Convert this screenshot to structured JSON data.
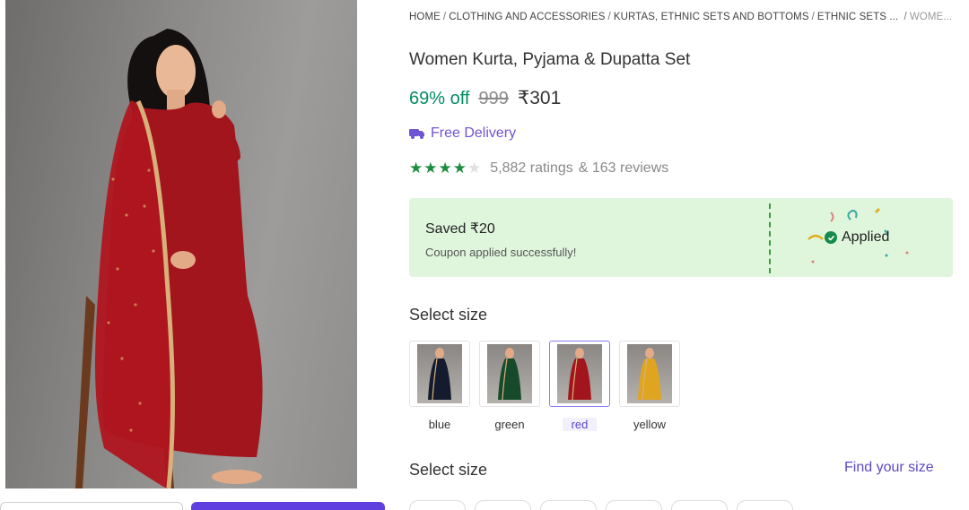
{
  "breadcrumb": [
    {
      "label": "HOME"
    },
    {
      "label": "CLOTHING AND ACCESSORIES"
    },
    {
      "label": "KURTAS, ETHNIC SETS AND BOTTOMS"
    },
    {
      "label": "ETHNIC SETS ..."
    },
    {
      "label": "WOME..."
    }
  ],
  "product": {
    "title": "Women Kurta, Pyjama & Dupatta Set",
    "discount": "69% off",
    "mrp": "999",
    "price": "₹301",
    "delivery": "Free Delivery",
    "rating_value": 4,
    "rating_max": 5,
    "ratings": "5,882 ratings",
    "reviews": "& 163 reviews"
  },
  "coupon": {
    "saved": "Saved ₹20",
    "message": "Coupon applied successfully!",
    "status": "Applied"
  },
  "color_section": {
    "title": "Select size",
    "options": [
      {
        "label": "blue",
        "selected": false,
        "dress_color": "#151b2e"
      },
      {
        "label": "green",
        "selected": false,
        "dress_color": "#164a2a"
      },
      {
        "label": "red",
        "selected": true,
        "dress_color": "#a3151c"
      },
      {
        "label": "yellow",
        "selected": false,
        "dress_color": "#e0a520"
      }
    ]
  },
  "size_section": {
    "title": "Select size",
    "find_size": "Find your size"
  },
  "colors": {
    "accent": "#5a48c8",
    "discount": "#038d63",
    "coupon_bg": "#dff6dd",
    "star": "#1c8c3e"
  }
}
